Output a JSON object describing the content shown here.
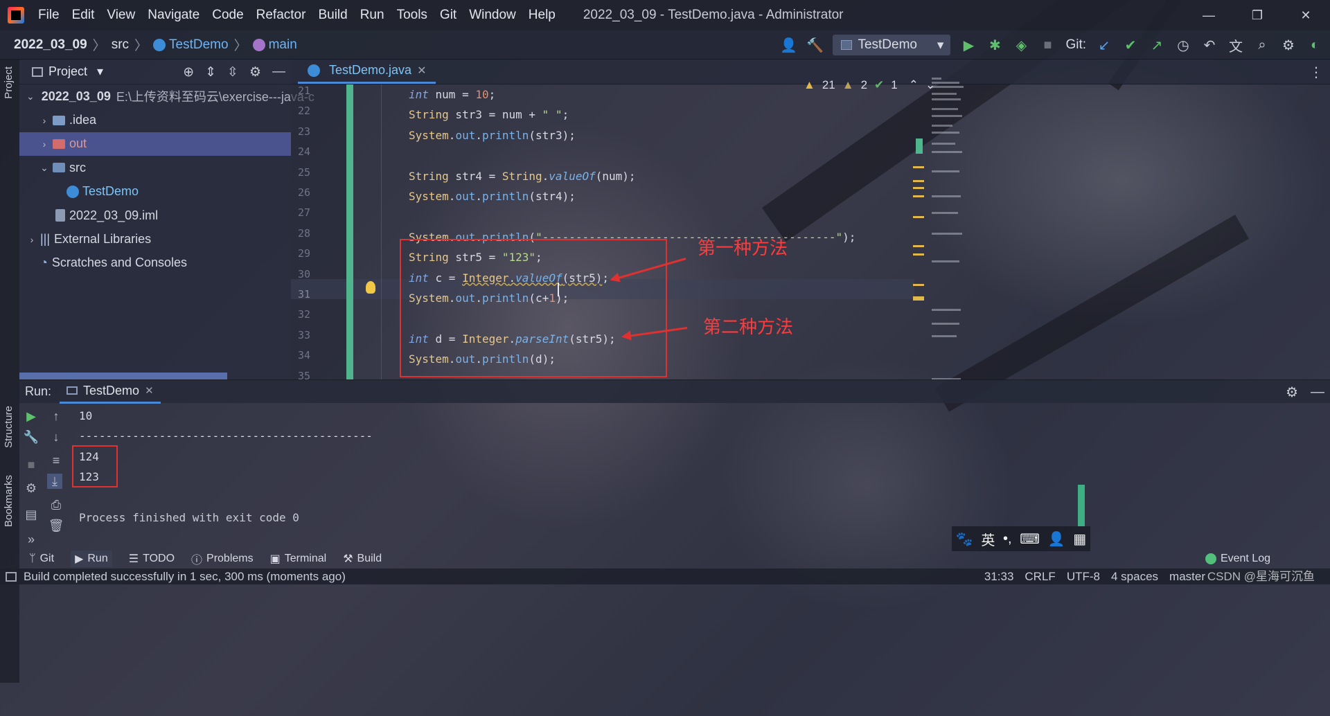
{
  "app": {
    "title": "2022_03_09 - TestDemo.java - Administrator",
    "logo_icon": "intellij-logo-icon"
  },
  "menu": [
    "File",
    "Edit",
    "View",
    "Navigate",
    "Code",
    "Refactor",
    "Build",
    "Run",
    "Tools",
    "Git",
    "Window",
    "Help"
  ],
  "window_controls": {
    "minimize": "—",
    "restore": "❐",
    "close": "✕"
  },
  "breadcrumb": {
    "project": "2022_03_09",
    "src": "src",
    "class": "TestDemo",
    "method": "main"
  },
  "toolbar": {
    "run_config": "TestDemo",
    "git_label": "Git:"
  },
  "side_labels": {
    "project": "Project",
    "structure": "Structure",
    "bookmarks": "Bookmarks"
  },
  "project_panel": {
    "title": "Project",
    "tree": [
      {
        "label": "2022_03_09",
        "path": "E:\\上传资料至码云\\exercise---java-c",
        "level": 0,
        "expanded": true,
        "kind": "project"
      },
      {
        "label": ".idea",
        "level": 1,
        "expanded": false,
        "kind": "folder"
      },
      {
        "label": "out",
        "level": 1,
        "expanded": false,
        "kind": "folder-excluded",
        "selected": true
      },
      {
        "label": "src",
        "level": 1,
        "expanded": true,
        "kind": "folder-src"
      },
      {
        "label": "TestDemo",
        "level": 2,
        "kind": "class"
      },
      {
        "label": "2022_03_09.iml",
        "level": 1,
        "kind": "iml"
      },
      {
        "label": "External Libraries",
        "level": 0,
        "expanded": false,
        "kind": "libraries"
      },
      {
        "label": "Scratches and Consoles",
        "level": 0,
        "kind": "scratches"
      }
    ]
  },
  "editor": {
    "tab_label": "TestDemo.java",
    "inspections": {
      "warnings_a": "21",
      "warnings_b": "2",
      "ok": "1"
    },
    "line_numbers": [
      "21",
      "22",
      "23",
      "24",
      "25",
      "26",
      "27",
      "28",
      "29",
      "30",
      "31",
      "32",
      "33",
      "34",
      "35"
    ],
    "current_line": "31"
  },
  "annotations": {
    "method1": "第一种方法",
    "method2": "第二种方法"
  },
  "run_panel": {
    "label": "Run:",
    "tab": "TestDemo",
    "output": [
      "10",
      "--------------------------------------------",
      "124",
      "123",
      "",
      "Process finished with exit code 0"
    ]
  },
  "tool_windows": [
    "Git",
    "Run",
    "TODO",
    "Problems",
    "Terminal",
    "Build"
  ],
  "event_log": "Event Log",
  "ime": [
    "🐾",
    "英",
    "•,",
    "⌨",
    "👤",
    "▦"
  ],
  "status": {
    "message": "Build completed successfully in 1 sec, 300 ms (moments ago)",
    "position": "31:33",
    "line_sep": "CRLF",
    "encoding": "UTF-8",
    "indent": "4 spaces",
    "branch": "master"
  },
  "watermark": "CSDN @星海可沉鱼"
}
